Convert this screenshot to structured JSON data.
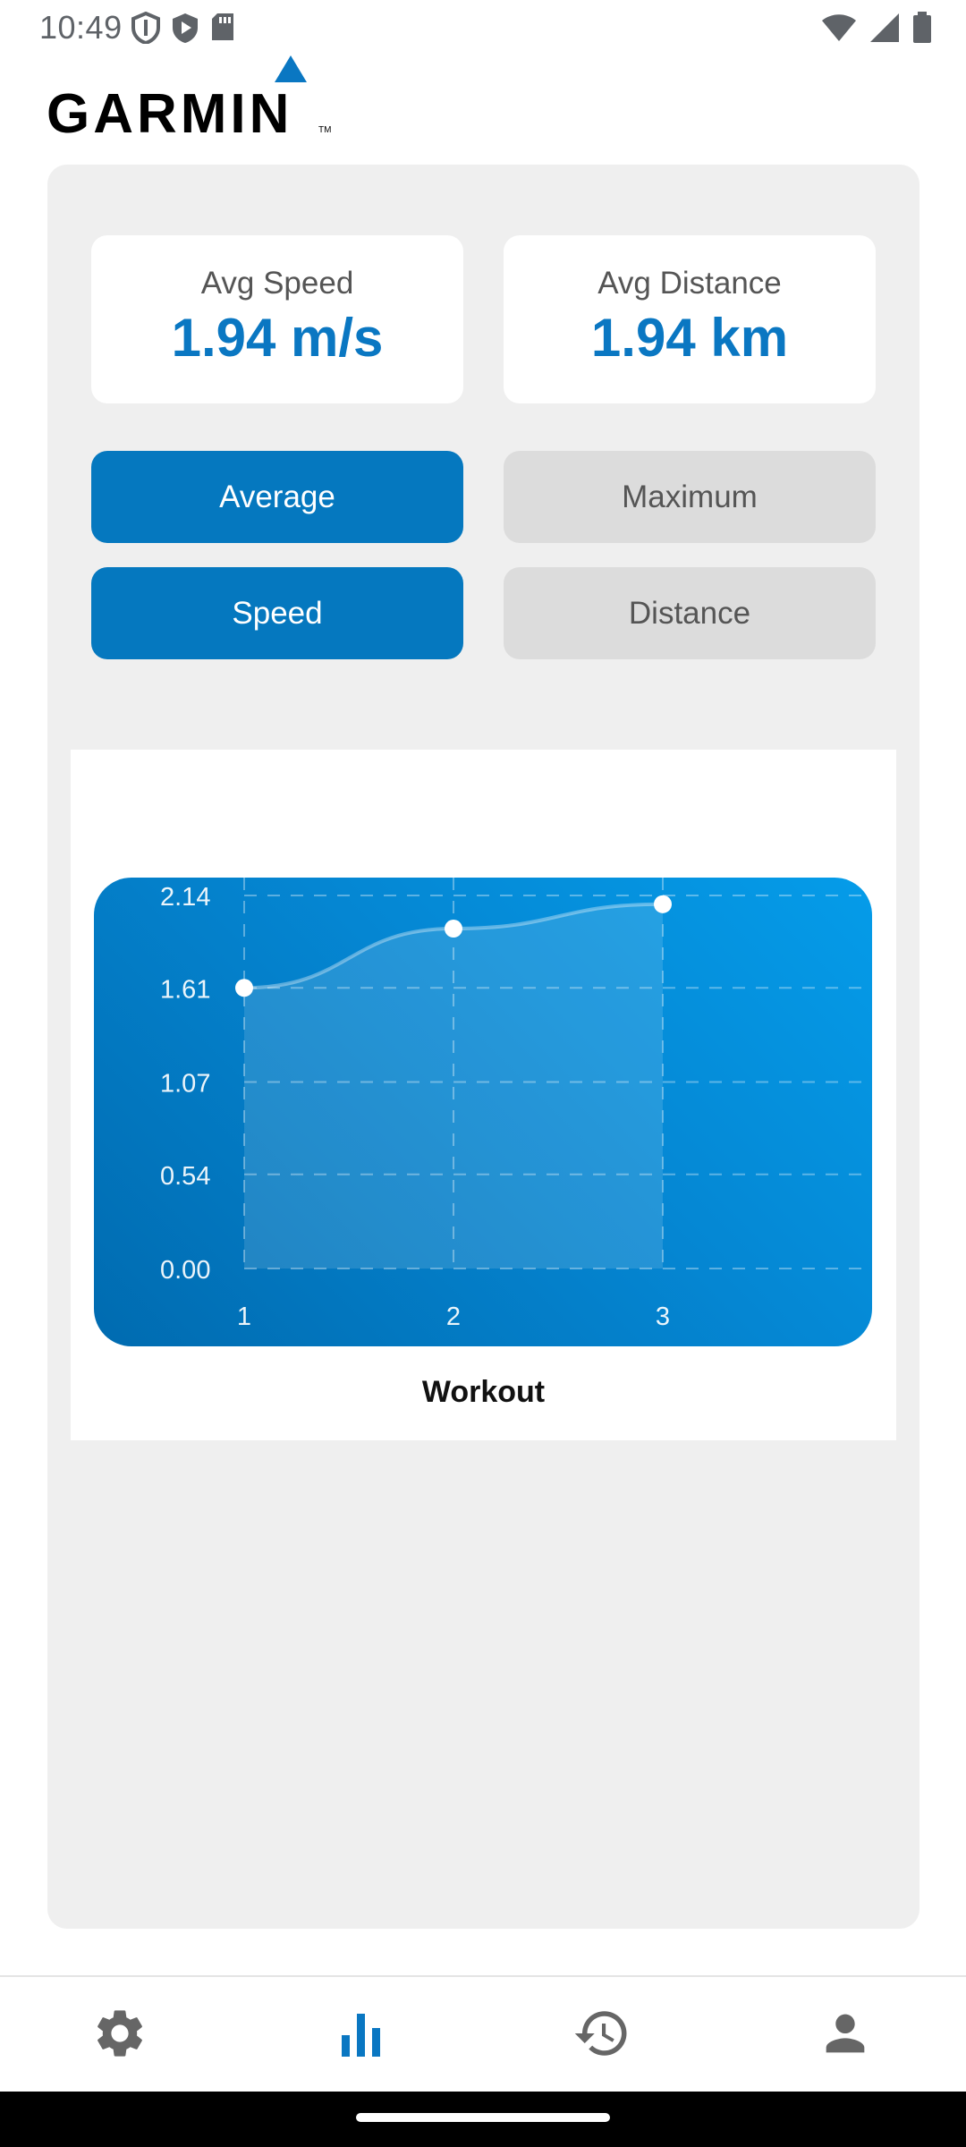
{
  "status_bar": {
    "time": "10:49",
    "left_icons": [
      "shield-outline-icon",
      "play-shield-icon",
      "sd-card-icon"
    ],
    "right_icons": [
      "wifi-icon",
      "signal-icon",
      "battery-icon"
    ]
  },
  "header": {
    "brand": "GARMIN",
    "trademark": "TM"
  },
  "stats": {
    "avg_speed": {
      "label": "Avg Speed",
      "value": "1.94 m/s"
    },
    "avg_distance": {
      "label": "Avg Distance",
      "value": "1.94 km"
    }
  },
  "toggles": {
    "average_label": "Average",
    "maximum_label": "Maximum",
    "speed_label": "Speed",
    "distance_label": "Distance",
    "selected_mode": "Average",
    "selected_metric": "Speed"
  },
  "chart_data": {
    "type": "area",
    "x": [
      1,
      2,
      3
    ],
    "values": [
      1.61,
      1.95,
      2.09
    ],
    "y_ticks": [
      "2.14",
      "1.61",
      "1.07",
      "0.54",
      "0.00"
    ],
    "x_ticks": [
      "1",
      "2",
      "3"
    ],
    "ylim": [
      0,
      2.14
    ],
    "grid": true,
    "caption": "Workout"
  },
  "bottom_nav": {
    "items": [
      "gear-icon",
      "bar-chart-icon",
      "history-icon",
      "person-icon"
    ],
    "active": "bar-chart-icon"
  },
  "colors": {
    "accent": "#0578bf",
    "value_text": "#0a77c2",
    "inactive_button": "#dcdcdc",
    "panel": "#efefef"
  }
}
